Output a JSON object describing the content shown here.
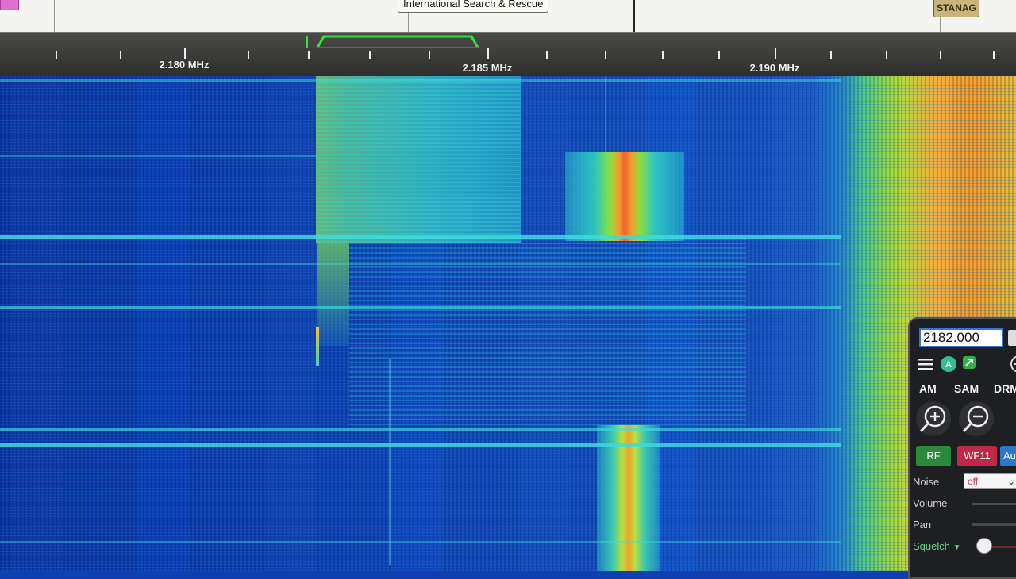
{
  "top_bar": {
    "band_label": "International Search & Rescue",
    "stanag_label": "STANAG"
  },
  "scale": {
    "labels": [
      "2.180 MHz",
      "2.185 MHz",
      "2.190 MHz"
    ]
  },
  "colors": {
    "passband": "#33e040",
    "waterfall_bg": "#1146b8",
    "signal_hot": "#f0a030",
    "trace": "#3fe0e0"
  },
  "panel": {
    "frequency": "2182.000",
    "modes": [
      "AM",
      "SAM",
      "DRM"
    ],
    "buttons": {
      "rf": "RF",
      "wf": "WF11",
      "auto": "Au"
    },
    "noise": {
      "label": "Noise",
      "value": "off"
    },
    "volume_label": "Volume",
    "pan_label": "Pan",
    "squelch_label": "Squelch"
  },
  "icons": [
    "menu-icon",
    "auto-icon",
    "expand-icon",
    "zoom-in-icon",
    "zoom-out-icon",
    "circle-minus-icon",
    "chevron-down-icon"
  ]
}
